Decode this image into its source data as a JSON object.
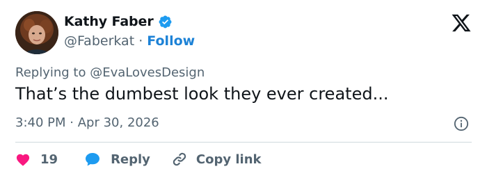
{
  "author": {
    "display_name": "Kathy Faber",
    "handle": "@Faberkat",
    "separator": "·",
    "follow_label": "Follow",
    "verified": true
  },
  "tweet": {
    "replying_prefix": "Replying to",
    "replying_to": "@EvaLovesDesign",
    "text": "That’s the dumbest look they ever created...",
    "time": "3:40 PM",
    "date_separator": "·",
    "date": "Apr 30, 2026"
  },
  "actions": {
    "like_count": "19",
    "reply_label": "Reply",
    "copy_link_label": "Copy link"
  },
  "icons": {
    "brand": "x-logo-icon",
    "verified": "verified-badge-icon",
    "info": "info-icon",
    "like": "heart-icon",
    "reply": "speech-bubble-icon",
    "copy": "link-icon"
  },
  "colors": {
    "text_primary": "#0f1419",
    "text_secondary": "#536471",
    "accent_blue": "#1d82d6",
    "like_pink": "#f91880",
    "divider": "#cfd9de"
  }
}
